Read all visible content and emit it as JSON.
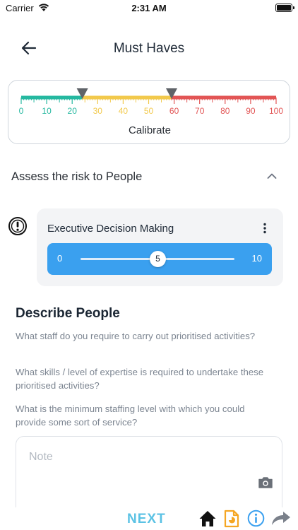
{
  "status_bar": {
    "carrier": "Carrier",
    "time": "2:31 AM"
  },
  "header": {
    "title": "Must Haves"
  },
  "calibrate": {
    "label": "Calibrate",
    "ticks": [
      "0",
      "10",
      "20",
      "30",
      "40",
      "50",
      "60",
      "70",
      "80",
      "90",
      "100"
    ],
    "low_marker": 24,
    "high_marker": 59,
    "colors": {
      "low": "#25b8a0",
      "mid": "#f2c94c",
      "high": "#e25555"
    }
  },
  "section": {
    "title": "Assess the risk to People"
  },
  "decision": {
    "title": "Executive Decision Making",
    "slider_min": "0",
    "slider_max": "10",
    "slider_value": "5"
  },
  "describe": {
    "title": "Describe People",
    "questions": [
      "What staff do you require to carry out prioritised activities?",
      "What skills / level of expertise is required to undertake these prioritised activities?",
      "What is the minimum staffing level with which you could provide some sort of service?"
    ]
  },
  "note": {
    "placeholder": "Note",
    "value": ""
  },
  "bottom_bar": {
    "next_label": "NEXT",
    "accent": "#5bc2e4"
  }
}
